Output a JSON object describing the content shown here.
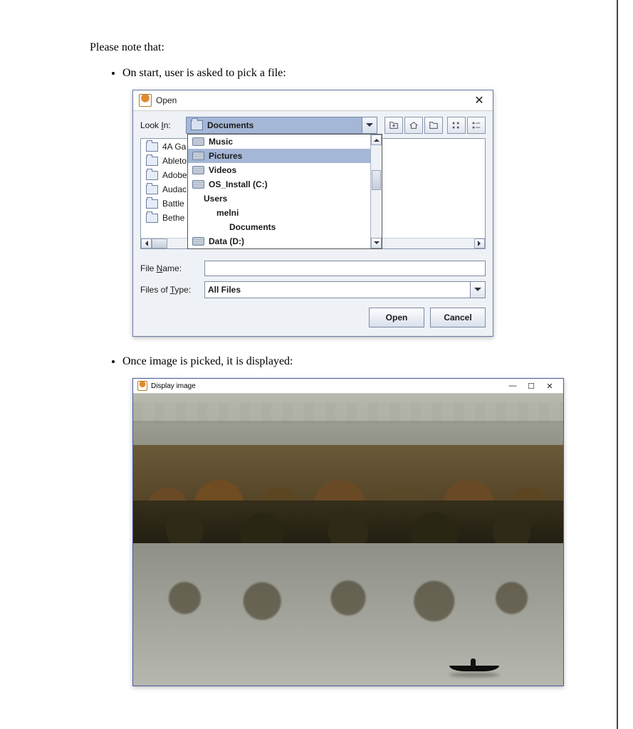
{
  "intro_text": "Please note that:",
  "bullets": {
    "b1": "On start, user is asked to pick a file:",
    "b2": "Once image is picked, it is displayed:"
  },
  "open_dialog": {
    "title": "Open",
    "look_in_label_prefix": "Look ",
    "look_in_mn": "I",
    "look_in_label_suffix": "n:",
    "look_in_value": "Documents",
    "left_items": [
      "4A Ga",
      "Ableto",
      "Adobe",
      "Audac",
      "Battle",
      "Bethe"
    ],
    "dropdown_items": [
      {
        "label": "Music",
        "icon": "disk",
        "indent": 0,
        "selected": false
      },
      {
        "label": "Pictures",
        "icon": "disk",
        "indent": 0,
        "selected": true
      },
      {
        "label": "Videos",
        "icon": "disk",
        "indent": 0,
        "selected": false
      },
      {
        "label": "OS_Install (C:)",
        "icon": "disk",
        "indent": 0,
        "selected": false
      },
      {
        "label": "Users",
        "icon": "folder",
        "indent": 1,
        "selected": false
      },
      {
        "label": "melni",
        "icon": "folder",
        "indent": 2,
        "selected": false
      },
      {
        "label": "Documents",
        "icon": "folder",
        "indent": 3,
        "selected": false
      },
      {
        "label": "Data (D:)",
        "icon": "disk",
        "indent": 0,
        "selected": false
      }
    ],
    "file_name_label_prefix": "File ",
    "file_name_mn": "N",
    "file_name_label_suffix": "ame:",
    "file_name_value": "",
    "filter_label_prefix": "Files of ",
    "filter_mn": "T",
    "filter_label_suffix": "ype:",
    "filter_value": "All Files",
    "open_btn": "Open",
    "cancel_btn": "Cancel"
  },
  "display_window": {
    "title": "Display image"
  }
}
